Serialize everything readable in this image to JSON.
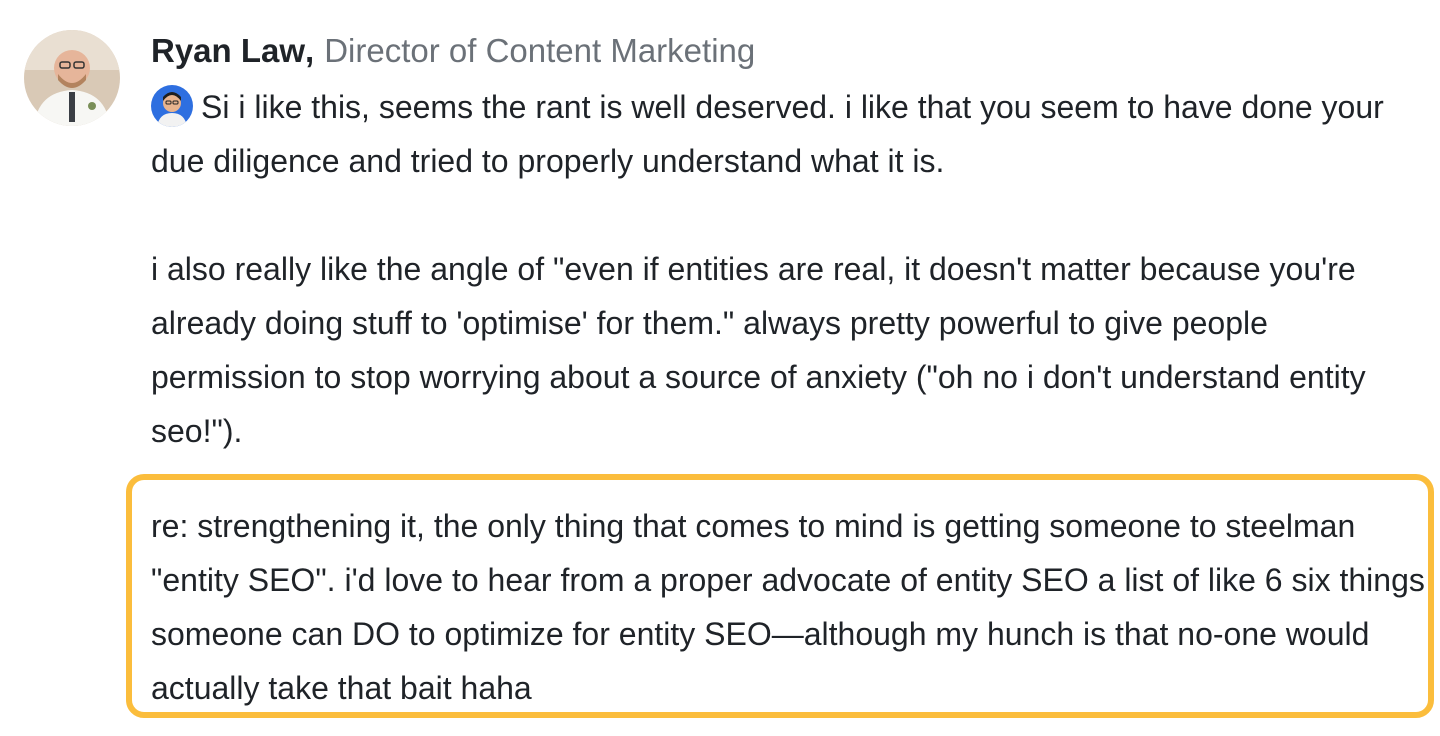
{
  "comment": {
    "author": "Ryan Law",
    "separator": ",",
    "role": "Director of Content Marketing",
    "paragraph1": "Si i like this, seems the rant is well deserved. i like that you seem to have done your due diligence and tried to properly understand what it is.",
    "paragraph2": "i also really like the angle of \"even if entities are real, it doesn't matter because you're already doing stuff to 'optimise' for them.\" always pretty powerful to give people permission to stop worrying about a source of anxiety (\"oh no i don't understand entity seo!\").",
    "paragraph3": "re: strengthening it, the only thing that comes to mind is getting someone to steelman \"entity SEO\". i'd love to hear from a proper advocate of entity SEO a list of like 6 six things someone can DO to optimize for entity SEO—although my hunch is that no-one would actually take that bait haha"
  },
  "colors": {
    "highlight_border": "#fbbd3c",
    "role_text": "#6b7178",
    "body_text": "#1f2328"
  }
}
